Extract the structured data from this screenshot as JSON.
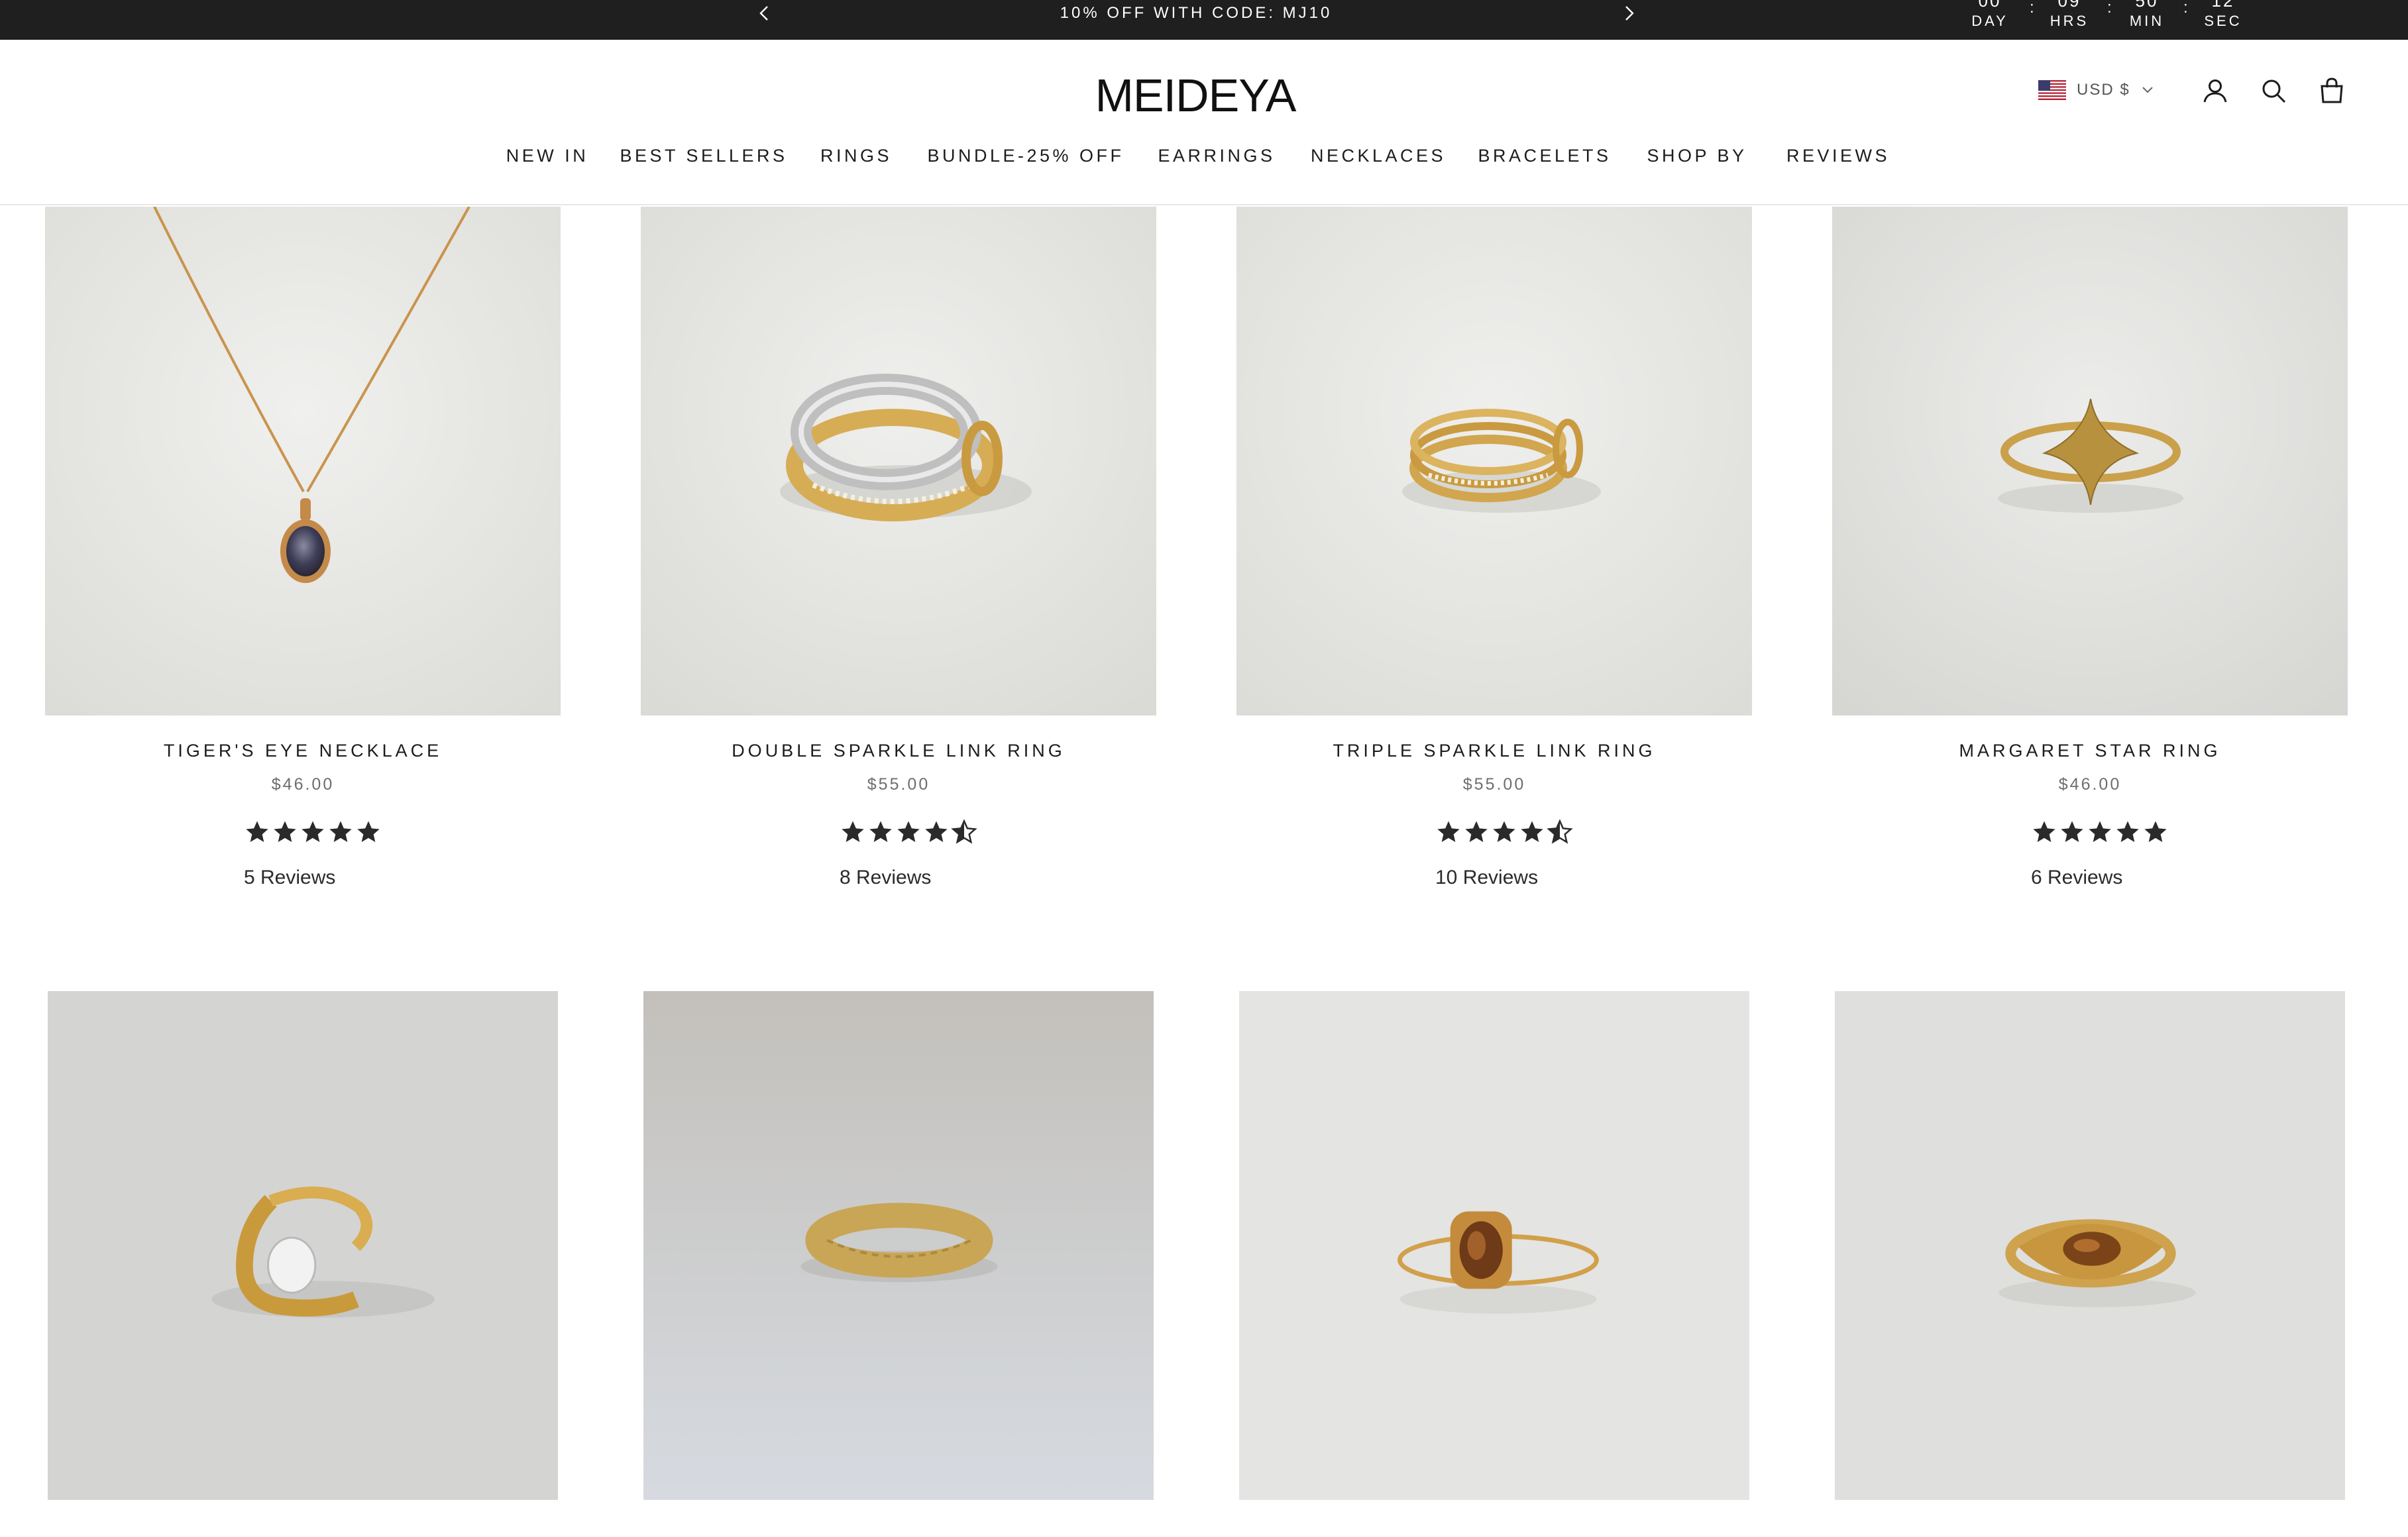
{
  "announcement": {
    "message": "10% OFF WITH CODE: MJ10",
    "countdown": [
      {
        "value": "00",
        "label": "DAY"
      },
      {
        "value": "09",
        "label": "HRS"
      },
      {
        "value": "50",
        "label": "MIN"
      },
      {
        "value": "12",
        "label": "SEC"
      }
    ],
    "separator": ":"
  },
  "header": {
    "logo": "MEIDEYA",
    "currency": "USD $",
    "nav": [
      "NEW IN",
      "BEST SELLERS",
      "RINGS",
      "BUNDLE-25% OFF",
      "EARRINGS",
      "NECKLACES",
      "BRACELETS",
      "SHOP BY",
      "REVIEWS"
    ]
  },
  "products": [
    {
      "title": "TIGER'S EYE NECKLACE",
      "price": "$46.00",
      "rating": 5,
      "reviews": "5 Reviews"
    },
    {
      "title": "DOUBLE SPARKLE LINK RING",
      "price": "$55.00",
      "rating": 4.5,
      "reviews": "8 Reviews"
    },
    {
      "title": "TRIPLE SPARKLE LINK RING",
      "price": "$55.00",
      "rating": 4.5,
      "reviews": "10 Reviews"
    },
    {
      "title": "MARGARET STAR RING",
      "price": "$46.00",
      "rating": 5,
      "reviews": "6 Reviews"
    },
    {
      "title": "",
      "price": "",
      "rating": null,
      "reviews": ""
    },
    {
      "title": "",
      "price": "",
      "rating": null,
      "reviews": ""
    },
    {
      "title": "",
      "price": "",
      "rating": null,
      "reviews": ""
    },
    {
      "title": "",
      "price": "",
      "rating": null,
      "reviews": ""
    }
  ],
  "colors": {
    "announcement_bg": "#1f1f1f",
    "text": "#1c1c1c",
    "price": "#6e6e6e",
    "star": "#2a2a2a",
    "gold": "#c9a24a",
    "silver": "#c8c8c8"
  }
}
